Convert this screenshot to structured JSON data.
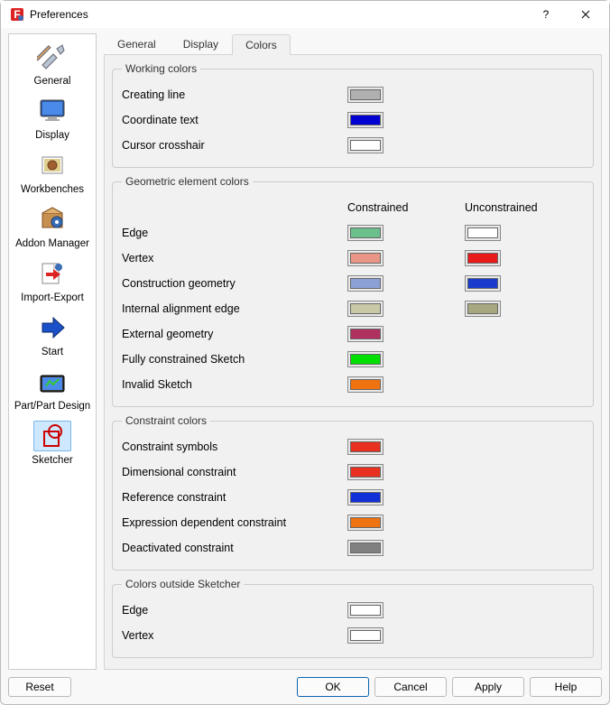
{
  "window": {
    "title": "Preferences"
  },
  "sidebar": {
    "items": [
      {
        "label": "General"
      },
      {
        "label": "Display"
      },
      {
        "label": "Workbenches"
      },
      {
        "label": "Addon Manager"
      },
      {
        "label": "Import-Export"
      },
      {
        "label": "Start"
      },
      {
        "label": "Part/Part Design"
      },
      {
        "label": "Sketcher"
      }
    ]
  },
  "tabs": {
    "t0": "General",
    "t1": "Display",
    "t2": "Colors"
  },
  "groups": {
    "working": {
      "legend": "Working colors",
      "creating_line": {
        "label": "Creating line",
        "color": "#b0b0b0"
      },
      "coord_text": {
        "label": "Coordinate text",
        "color": "#0000d0"
      },
      "cursor": {
        "label": "Cursor crosshair",
        "color": "#ffffff"
      }
    },
    "geom": {
      "legend": "Geometric element colors",
      "head_con": "Constrained",
      "head_unc": "Unconstrained",
      "edge": {
        "label": "Edge",
        "c": "#6abf8b",
        "u": "#ffffff"
      },
      "vertex": {
        "label": "Vertex",
        "c": "#e99686",
        "u": "#e81a1a"
      },
      "construction": {
        "label": "Construction geometry",
        "c": "#8ba0d6",
        "u": "#1a3ccc"
      },
      "internal": {
        "label": "Internal alignment edge",
        "c": "#c9c9a8",
        "u": "#a8a880"
      },
      "external": {
        "label": "External geometry",
        "color": "#b03060"
      },
      "fully": {
        "label": "Fully constrained Sketch",
        "color": "#00e000"
      },
      "invalid": {
        "label": "Invalid Sketch",
        "color": "#ef7310"
      }
    },
    "constraint": {
      "legend": "Constraint colors",
      "symbols": {
        "label": "Constraint symbols",
        "color": "#e83020"
      },
      "dimensional": {
        "label": "Dimensional constraint",
        "color": "#e83020"
      },
      "reference": {
        "label": "Reference constraint",
        "color": "#1030d8"
      },
      "expression": {
        "label": "Expression dependent constraint",
        "color": "#ef7310"
      },
      "deactivated": {
        "label": "Deactivated constraint",
        "color": "#808080"
      }
    },
    "outside": {
      "legend": "Colors outside Sketcher",
      "edge": {
        "label": "Edge",
        "color": "#ffffff"
      },
      "vertex": {
        "label": "Vertex",
        "color": "#ffffff"
      }
    }
  },
  "footer": {
    "reset": "Reset",
    "ok": "OK",
    "cancel": "Cancel",
    "apply": "Apply",
    "help": "Help"
  }
}
